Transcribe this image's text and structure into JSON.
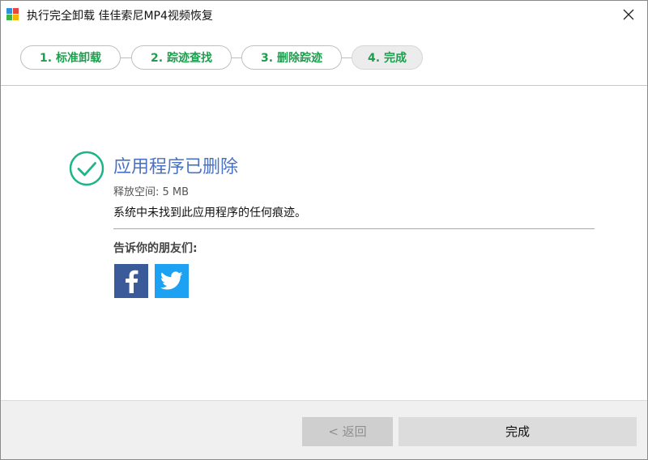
{
  "window": {
    "title": "执行完全卸载  佳佳索尼MP4视频恢复"
  },
  "steps": [
    {
      "label": "1. 标准卸载"
    },
    {
      "label": "2. 踪迹查找"
    },
    {
      "label": "3. 删除踪迹"
    },
    {
      "label": "4. 完成"
    }
  ],
  "result": {
    "title": "应用程序已删除",
    "freed_space": "释放空间: 5 MB",
    "traces_message": "系统中未找到此应用程序的任何痕迹。"
  },
  "share": {
    "label": "告诉你的朋友们:",
    "icons": [
      "facebook-icon",
      "twitter-icon"
    ]
  },
  "footer": {
    "back_label": "< 返回",
    "finish_label": "完成"
  },
  "colors": {
    "step_text": "#1e9e4f",
    "result_title": "#4a72c4",
    "check": "#1fb487",
    "facebook": "#3b5a9a",
    "twitter": "#1da1f2"
  }
}
